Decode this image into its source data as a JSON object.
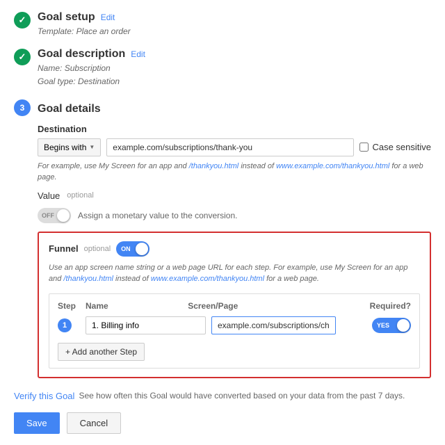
{
  "sections": {
    "goal_setup": {
      "title": "Goal setup",
      "edit_label": "Edit",
      "template_label": "Template:",
      "template_value": "Place an order"
    },
    "goal_description": {
      "title": "Goal description",
      "edit_label": "Edit",
      "name_label": "Name:",
      "name_value": "Subscription",
      "type_label": "Goal type:",
      "type_value": "Destination"
    },
    "goal_details": {
      "title": "Goal details",
      "step_number": "3",
      "destination_label": "Destination",
      "begins_with": "Begins with",
      "destination_value": "example.com/subscriptions/thank-you",
      "case_sensitive_label": "Case sensitive",
      "hint": "For example, use",
      "hint_my_screen": "My Screen",
      "hint_middle": "for an app and",
      "hint_thankyou": "/thankyou.html",
      "hint_middle2": "instead of",
      "hint_url": "www.example.com/thankyou.html",
      "hint_end": "for a web page.",
      "value_label": "Value",
      "value_optional": "optional",
      "toggle_off_label": "OFF",
      "value_hint": "Assign a monetary value to the conversion.",
      "funnel": {
        "label": "Funnel",
        "optional": "optional",
        "toggle_on_label": "ON",
        "hint_part1": "Use an app screen name string or a web page URL for each step. For example, use",
        "hint_my_screen": "My Screen",
        "hint_part2": "for an app and",
        "hint_thankyou": "/thankyou.html",
        "hint_part3": "instead of",
        "hint_url": "www.example.com/thankyou.html",
        "hint_part4": "for a web page.",
        "steps_header": {
          "step": "Step",
          "name": "Name",
          "screen_page": "Screen/Page",
          "required": "Required?"
        },
        "steps": [
          {
            "number": "1",
            "name": "1. Billing info",
            "page": "example.com/subscriptions/checkout",
            "required": "YES"
          }
        ],
        "add_step_label": "+ Add another Step"
      }
    }
  },
  "verify": {
    "link": "Verify this Goal",
    "description": "See how often this Goal would have converted based on your data from the past 7 days."
  },
  "buttons": {
    "save": "Save",
    "cancel": "Cancel"
  }
}
